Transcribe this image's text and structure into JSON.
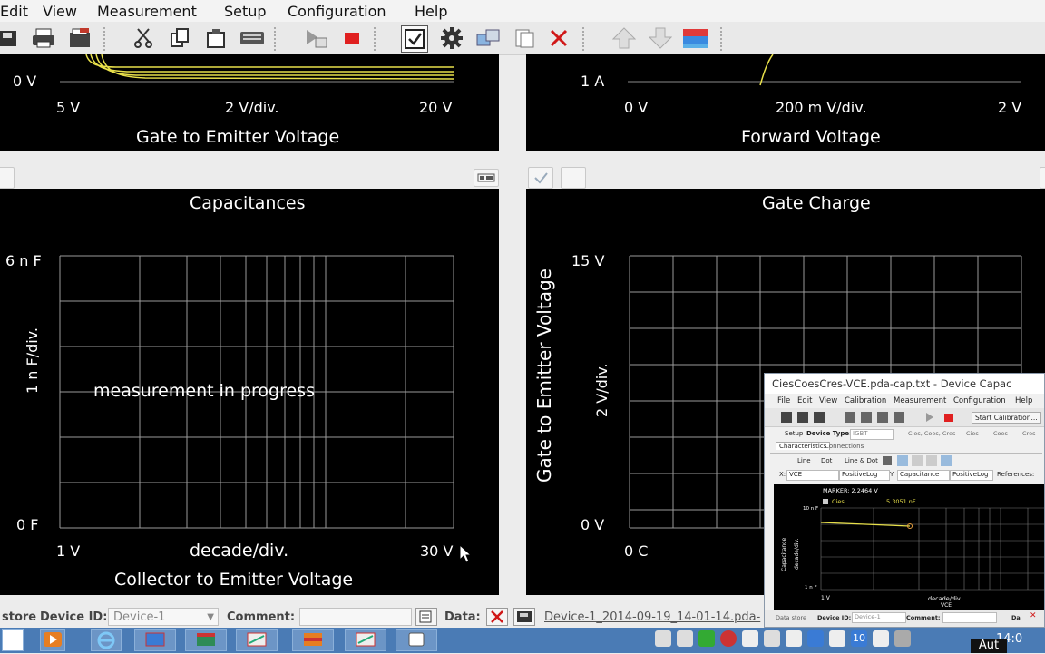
{
  "menu": [
    "Edit",
    "View",
    "Measurement",
    "Setup",
    "Configuration",
    "Help"
  ],
  "panels": {
    "gate_emitter": {
      "y_tick": "0  V",
      "x_start": "5  V",
      "x_scale": "2  V/div.",
      "x_end": "20  V",
      "x_title": "Gate to Emitter Voltage"
    },
    "forward": {
      "y_tick": "1  A",
      "x_start": "0  V",
      "x_scale": "200 m  V/div.",
      "x_end": "2  V",
      "x_title": "Forward Voltage"
    },
    "capacitances": {
      "title": "Capacitances",
      "y_top": "6 n F",
      "y_bottom": "0  F",
      "y_scale": "1 n F/div.",
      "message": "measurement in progress",
      "x_start": "1  V",
      "x_scale": "decade/div.",
      "x_end": "30  V",
      "x_title": "Collector to Emitter Voltage"
    },
    "gate_charge": {
      "title": "Gate Charge",
      "y_top": "15  V",
      "y_bottom": "0  V",
      "y_scale": "2  V/div.",
      "y_title": "Gate to Emitter Voltage",
      "x_start": "0  C"
    }
  },
  "statusbar": {
    "store_label": "store",
    "device_id_label": "Device ID:",
    "device_id_value": "Device-1",
    "comment_label": "Comment:",
    "data_label": "Data:",
    "data_file": "Device-1_2014-09-19_14-01-14.pda-"
  },
  "inset": {
    "title": "CiesCoesCres-VCE.pda-cap.txt - Device Capac",
    "menu": [
      "File",
      "Edit",
      "View",
      "Calibration",
      "Measurement",
      "Configuration",
      "Help"
    ],
    "toolbar_button": "Start Calibration...",
    "setup_label": "Setup",
    "device_type_label": "Device Type:",
    "device_type_value": "IGBT",
    "setup_options": [
      "Cies, Coes, Cres",
      "Cies",
      "Coes",
      "Cres"
    ],
    "tabs": [
      "Characteristics",
      "Connections"
    ],
    "line_options": [
      "Line",
      "Dot",
      "Line & Dot"
    ],
    "x_label": "X:",
    "x_value": "VCE",
    "x_scale": "PositiveLog",
    "y_label": "Y:",
    "y_value": "Capacitance",
    "y_scale": "PositiveLog",
    "references_label": "References:",
    "marker": "MARKER: 2.2464 V",
    "series": "Cies",
    "series_value": "5.3051 nF",
    "y_top": "10 n F",
    "y_bottom": "1 n F",
    "y_axis": "Capacitance",
    "y_div": "decade/div.",
    "x_start": "1  V",
    "x_div": "decade/div.",
    "x_axis": "VCE",
    "status_store": "Data store",
    "status_device": "Device ID:",
    "status_device_value": "Device-1",
    "status_comment": "Comment:",
    "status_da": "Da"
  },
  "taskbar": {
    "clock": "14:0",
    "badge": "10",
    "aut": "Aut"
  },
  "colors": {
    "trace": "#e8e04a",
    "panel_bg": "#000000",
    "grid": "#9a9a9a",
    "taskbar": "#4a7bb5"
  }
}
